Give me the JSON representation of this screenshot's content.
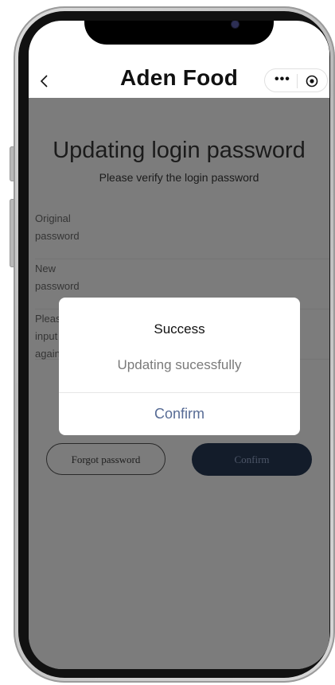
{
  "header": {
    "title": "Aden Food",
    "back_icon": "chevron-left-icon",
    "more_icon": "more-dots-icon",
    "close_icon": "target-circle-icon"
  },
  "page": {
    "title": "Updating login password",
    "subtitle": "Please verify the login password",
    "fields": [
      {
        "label": "Original password"
      },
      {
        "label": "New password"
      },
      {
        "label": "Please input it again"
      }
    ],
    "forgot_button": "Forgot password",
    "confirm_button": "Confirm"
  },
  "dialog": {
    "title": "Success",
    "message": "Updating sucessfully",
    "confirm": "Confirm"
  },
  "colors": {
    "overlay": "#7c7c7c",
    "primary_button": "#131c2a",
    "dialog_link": "#576b95"
  }
}
